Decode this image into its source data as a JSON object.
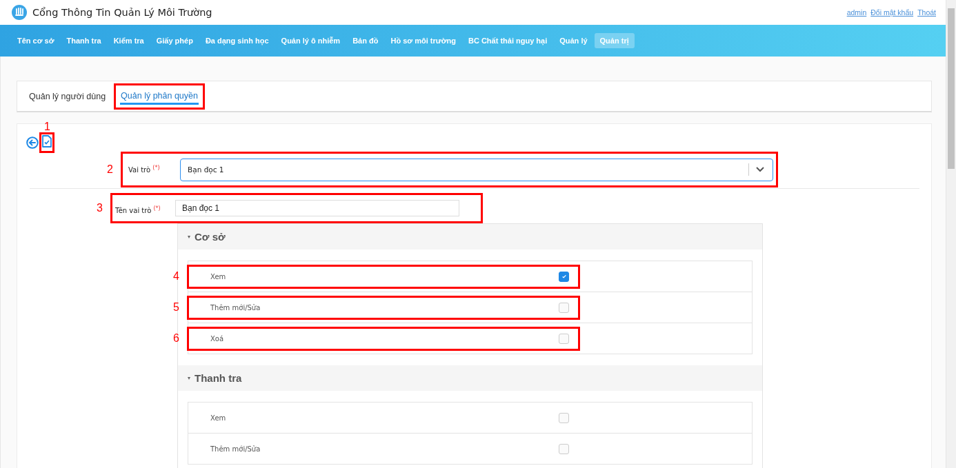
{
  "header": {
    "title": "Cổng Thông Tin Quản Lý Môi Trường",
    "links": [
      "admin",
      "Đổi mật khẩu",
      "Thoát"
    ]
  },
  "nav": [
    {
      "label": "Tên cơ sở",
      "selected": false
    },
    {
      "label": "Thanh tra",
      "selected": false
    },
    {
      "label": "Kiểm tra",
      "selected": false
    },
    {
      "label": "Giấy phép",
      "selected": false
    },
    {
      "label": "Đa dạng sinh học",
      "selected": false
    },
    {
      "label": "Quản lý ô nhiễm",
      "selected": false
    },
    {
      "label": "Bản đồ",
      "selected": false
    },
    {
      "label": "Hồ sơ môi trường",
      "selected": false
    },
    {
      "label": "BC Chất thải nguy hại",
      "selected": false
    },
    {
      "label": "Quản lý",
      "selected": false
    },
    {
      "label": "Quản trị",
      "selected": true
    }
  ],
  "tabs": [
    {
      "label": "Quản lý người dùng",
      "selected": false,
      "highlighted": false
    },
    {
      "label": "Quản lý phân quyền",
      "selected": true,
      "highlighted": true
    }
  ],
  "toolbar": {
    "save_callout": "1"
  },
  "role_select": {
    "label": "Vai trò",
    "required_mark": "(*)",
    "value": "Bạn đọc 1",
    "callout": "2"
  },
  "role_name": {
    "label": "Tên vai trò",
    "required_mark": "(*)",
    "value": "Bạn đọc 1",
    "callout": "3"
  },
  "groups": [
    {
      "title": "Cơ sở",
      "expanded": true,
      "permissions": [
        {
          "label": "Xem",
          "checked": true,
          "callout": "4"
        },
        {
          "label": "Thêm mới/Sửa",
          "checked": false,
          "callout": "5"
        },
        {
          "label": "Xoá",
          "checked": false,
          "callout": "6"
        }
      ]
    },
    {
      "title": "Thanh tra",
      "expanded": true,
      "permissions": [
        {
          "label": "Xem",
          "checked": false
        },
        {
          "label": "Thêm mới/Sửa",
          "checked": false
        }
      ]
    }
  ]
}
